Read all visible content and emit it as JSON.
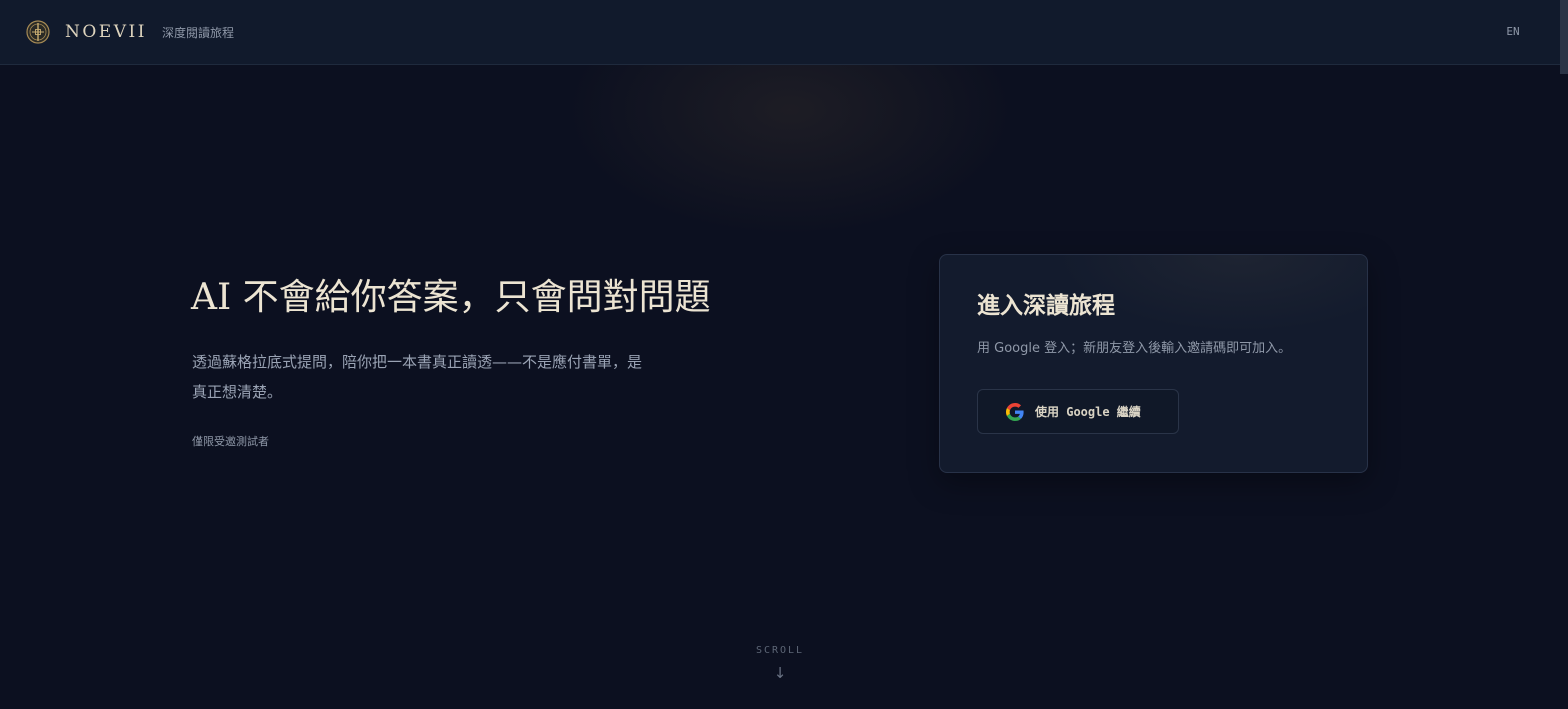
{
  "header": {
    "brand": "NOEVII",
    "brand_subtitle": "深度閱讀旅程",
    "language_toggle": "EN",
    "logo_icon": "emblem-logo-icon"
  },
  "hero": {
    "title": "AI 不會給你答案，只會問對問題",
    "description": "透過蘇格拉底式提問，陪你把一本書真正讀透——不是應付書單，是真正想清楚。",
    "invite_note": "僅限受邀測試者"
  },
  "login_card": {
    "title": "進入深讀旅程",
    "description": "用 Google 登入；新朋友登入後輸入邀請碼即可加入。",
    "google_button_label": "使用 Google 繼續",
    "google_icon": "google-logo-icon"
  },
  "scroll_hint": {
    "label": "SCROLL",
    "arrow": "↓"
  },
  "colors": {
    "background": "#0c1020",
    "header_bg": "#111a2c",
    "card_bg": "#131b2d",
    "title_text": "#ece4d2",
    "muted_text": "#8f98a8",
    "gold_accent": "#b89a5e"
  }
}
